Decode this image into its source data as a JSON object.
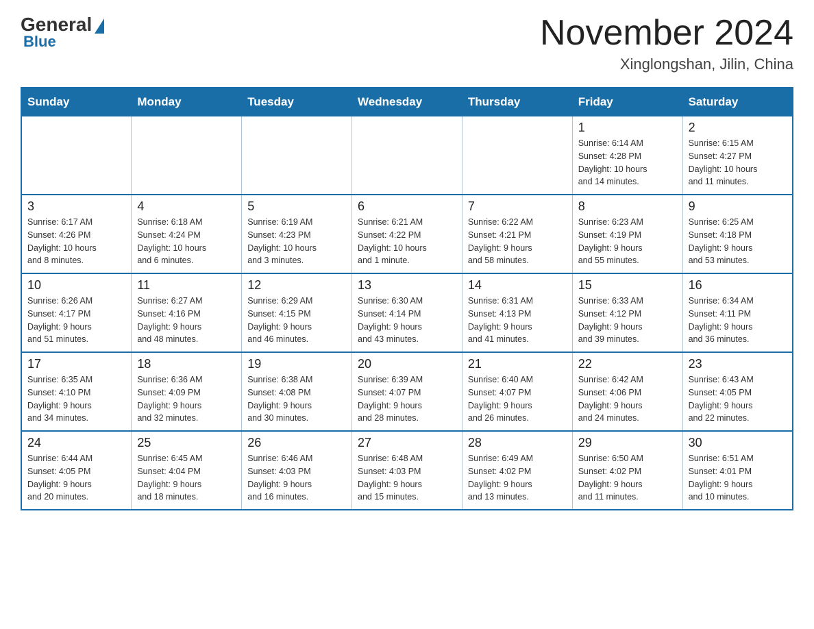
{
  "header": {
    "logo_general": "General",
    "logo_blue": "Blue",
    "month_title": "November 2024",
    "location": "Xinglongshan, Jilin, China"
  },
  "weekdays": [
    "Sunday",
    "Monday",
    "Tuesday",
    "Wednesday",
    "Thursday",
    "Friday",
    "Saturday"
  ],
  "weeks": [
    [
      {
        "day": "",
        "info": ""
      },
      {
        "day": "",
        "info": ""
      },
      {
        "day": "",
        "info": ""
      },
      {
        "day": "",
        "info": ""
      },
      {
        "day": "",
        "info": ""
      },
      {
        "day": "1",
        "info": "Sunrise: 6:14 AM\nSunset: 4:28 PM\nDaylight: 10 hours\nand 14 minutes."
      },
      {
        "day": "2",
        "info": "Sunrise: 6:15 AM\nSunset: 4:27 PM\nDaylight: 10 hours\nand 11 minutes."
      }
    ],
    [
      {
        "day": "3",
        "info": "Sunrise: 6:17 AM\nSunset: 4:26 PM\nDaylight: 10 hours\nand 8 minutes."
      },
      {
        "day": "4",
        "info": "Sunrise: 6:18 AM\nSunset: 4:24 PM\nDaylight: 10 hours\nand 6 minutes."
      },
      {
        "day": "5",
        "info": "Sunrise: 6:19 AM\nSunset: 4:23 PM\nDaylight: 10 hours\nand 3 minutes."
      },
      {
        "day": "6",
        "info": "Sunrise: 6:21 AM\nSunset: 4:22 PM\nDaylight: 10 hours\nand 1 minute."
      },
      {
        "day": "7",
        "info": "Sunrise: 6:22 AM\nSunset: 4:21 PM\nDaylight: 9 hours\nand 58 minutes."
      },
      {
        "day": "8",
        "info": "Sunrise: 6:23 AM\nSunset: 4:19 PM\nDaylight: 9 hours\nand 55 minutes."
      },
      {
        "day": "9",
        "info": "Sunrise: 6:25 AM\nSunset: 4:18 PM\nDaylight: 9 hours\nand 53 minutes."
      }
    ],
    [
      {
        "day": "10",
        "info": "Sunrise: 6:26 AM\nSunset: 4:17 PM\nDaylight: 9 hours\nand 51 minutes."
      },
      {
        "day": "11",
        "info": "Sunrise: 6:27 AM\nSunset: 4:16 PM\nDaylight: 9 hours\nand 48 minutes."
      },
      {
        "day": "12",
        "info": "Sunrise: 6:29 AM\nSunset: 4:15 PM\nDaylight: 9 hours\nand 46 minutes."
      },
      {
        "day": "13",
        "info": "Sunrise: 6:30 AM\nSunset: 4:14 PM\nDaylight: 9 hours\nand 43 minutes."
      },
      {
        "day": "14",
        "info": "Sunrise: 6:31 AM\nSunset: 4:13 PM\nDaylight: 9 hours\nand 41 minutes."
      },
      {
        "day": "15",
        "info": "Sunrise: 6:33 AM\nSunset: 4:12 PM\nDaylight: 9 hours\nand 39 minutes."
      },
      {
        "day": "16",
        "info": "Sunrise: 6:34 AM\nSunset: 4:11 PM\nDaylight: 9 hours\nand 36 minutes."
      }
    ],
    [
      {
        "day": "17",
        "info": "Sunrise: 6:35 AM\nSunset: 4:10 PM\nDaylight: 9 hours\nand 34 minutes."
      },
      {
        "day": "18",
        "info": "Sunrise: 6:36 AM\nSunset: 4:09 PM\nDaylight: 9 hours\nand 32 minutes."
      },
      {
        "day": "19",
        "info": "Sunrise: 6:38 AM\nSunset: 4:08 PM\nDaylight: 9 hours\nand 30 minutes."
      },
      {
        "day": "20",
        "info": "Sunrise: 6:39 AM\nSunset: 4:07 PM\nDaylight: 9 hours\nand 28 minutes."
      },
      {
        "day": "21",
        "info": "Sunrise: 6:40 AM\nSunset: 4:07 PM\nDaylight: 9 hours\nand 26 minutes."
      },
      {
        "day": "22",
        "info": "Sunrise: 6:42 AM\nSunset: 4:06 PM\nDaylight: 9 hours\nand 24 minutes."
      },
      {
        "day": "23",
        "info": "Sunrise: 6:43 AM\nSunset: 4:05 PM\nDaylight: 9 hours\nand 22 minutes."
      }
    ],
    [
      {
        "day": "24",
        "info": "Sunrise: 6:44 AM\nSunset: 4:05 PM\nDaylight: 9 hours\nand 20 minutes."
      },
      {
        "day": "25",
        "info": "Sunrise: 6:45 AM\nSunset: 4:04 PM\nDaylight: 9 hours\nand 18 minutes."
      },
      {
        "day": "26",
        "info": "Sunrise: 6:46 AM\nSunset: 4:03 PM\nDaylight: 9 hours\nand 16 minutes."
      },
      {
        "day": "27",
        "info": "Sunrise: 6:48 AM\nSunset: 4:03 PM\nDaylight: 9 hours\nand 15 minutes."
      },
      {
        "day": "28",
        "info": "Sunrise: 6:49 AM\nSunset: 4:02 PM\nDaylight: 9 hours\nand 13 minutes."
      },
      {
        "day": "29",
        "info": "Sunrise: 6:50 AM\nSunset: 4:02 PM\nDaylight: 9 hours\nand 11 minutes."
      },
      {
        "day": "30",
        "info": "Sunrise: 6:51 AM\nSunset: 4:01 PM\nDaylight: 9 hours\nand 10 minutes."
      }
    ]
  ]
}
